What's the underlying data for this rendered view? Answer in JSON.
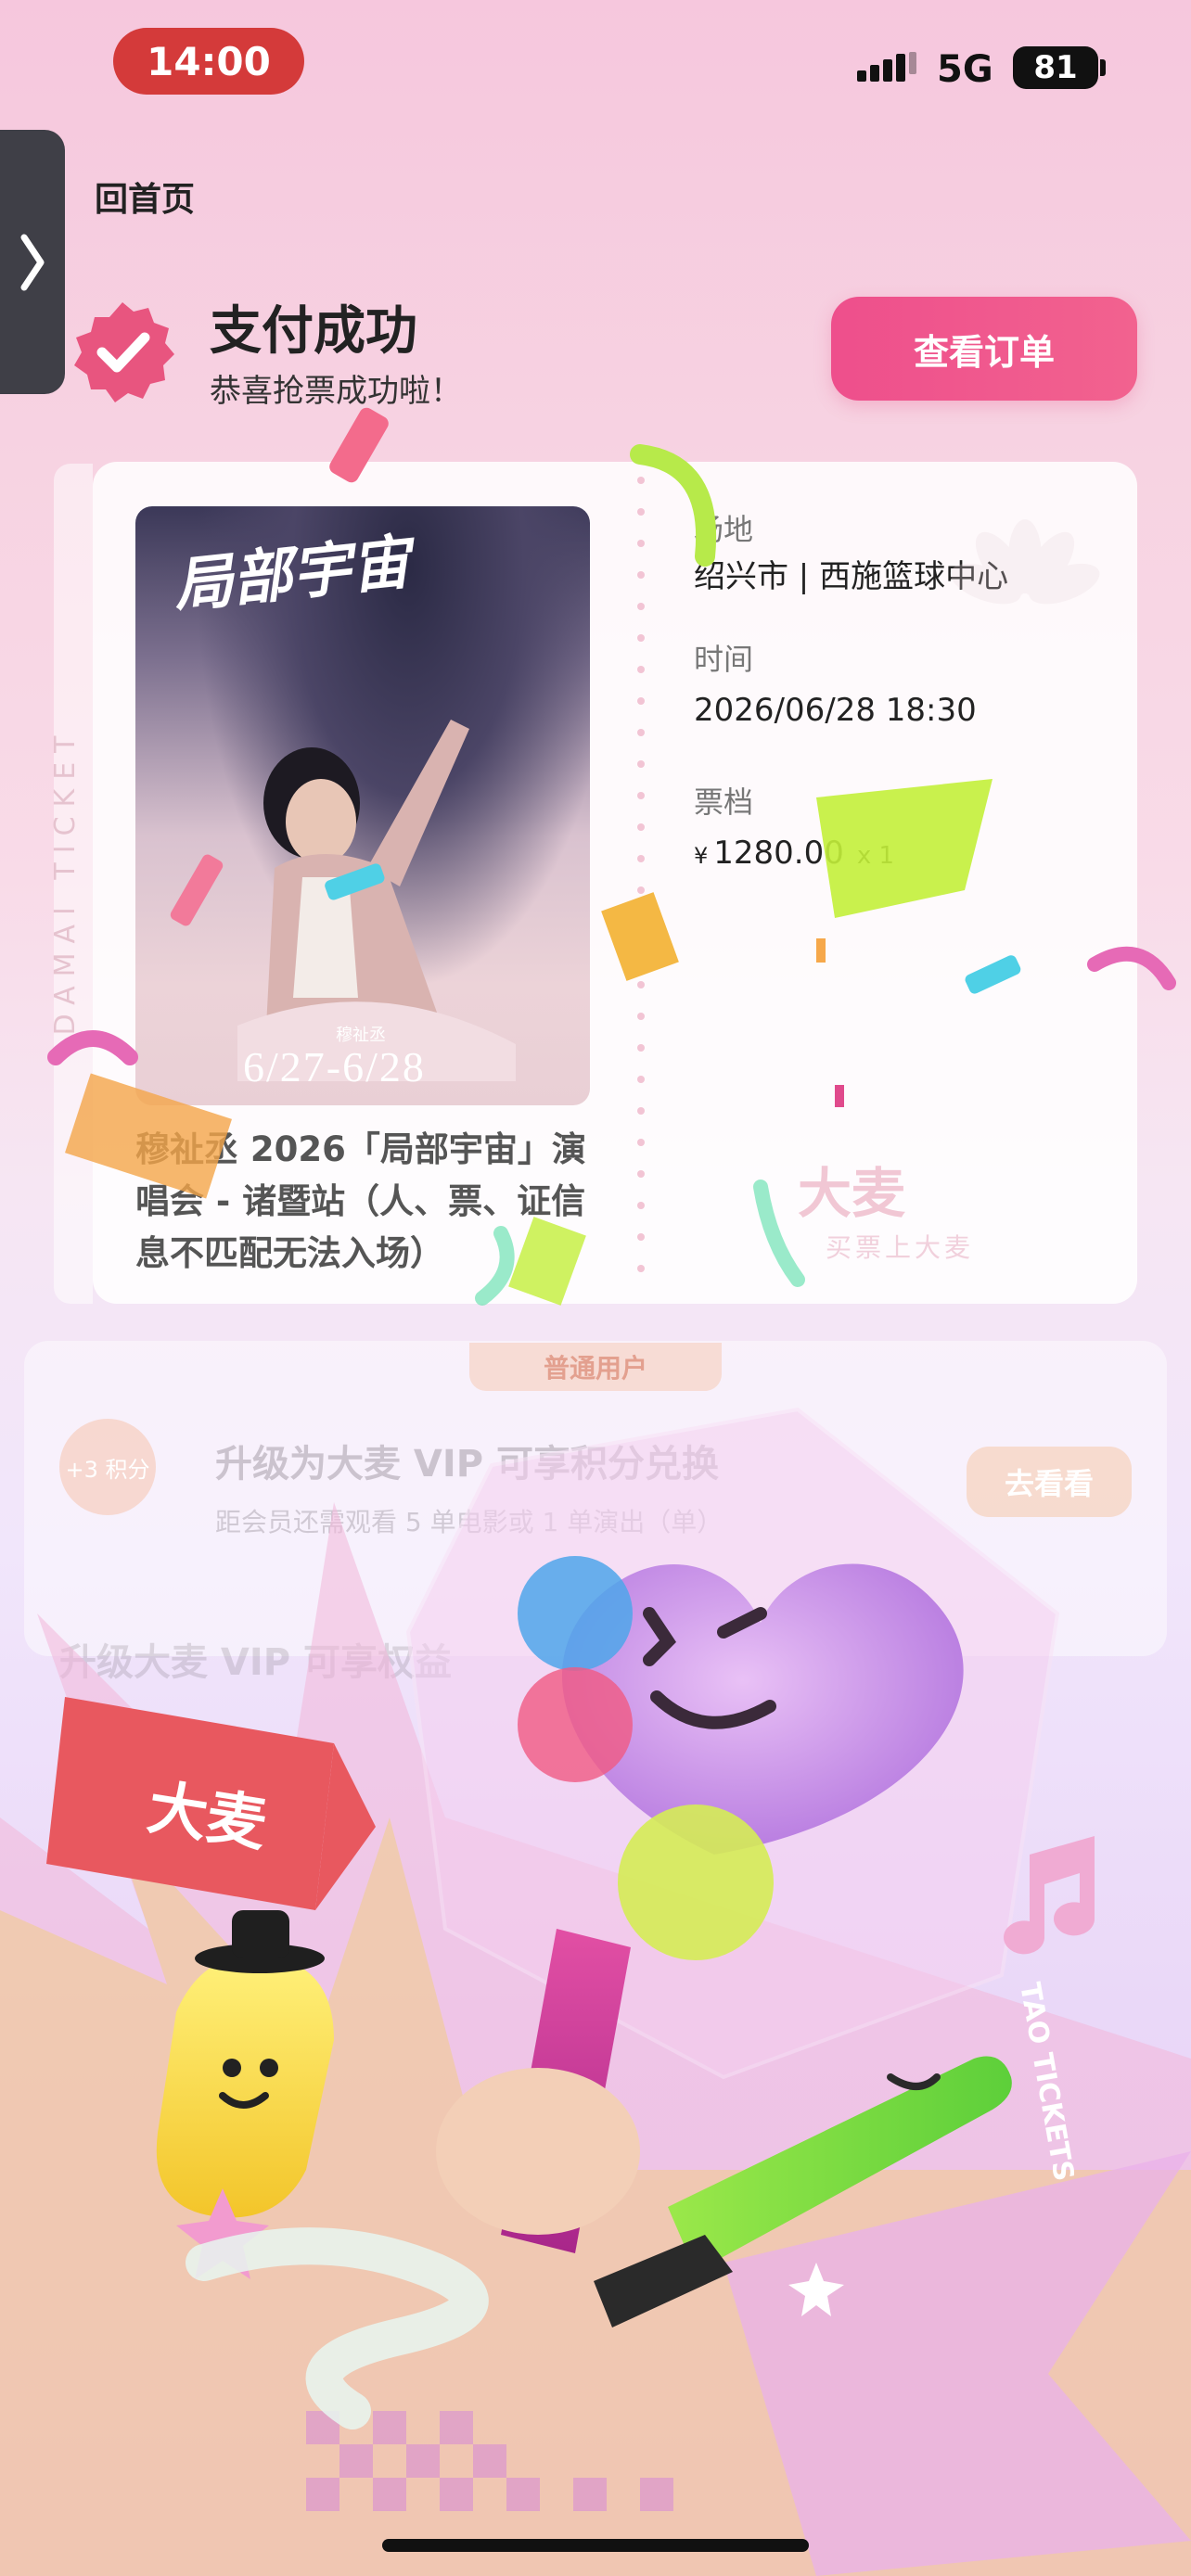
{
  "status_bar": {
    "time": "14:00",
    "network": "5G",
    "battery": "81"
  },
  "nav": {
    "home_link": "回首页"
  },
  "success": {
    "title": "支付成功",
    "subtitle": "恭喜抢票成功啦！",
    "view_order_label": "查看订单"
  },
  "ticket": {
    "side_text": "DAMAI TICKET",
    "poster": {
      "title": "局部宇宙",
      "artist": "穆祉丞",
      "date": "6/27-6/28"
    },
    "event_title": "穆祉丞 2026「局部宇宙」演唱会 - 诸暨站（人、票、证信息不匹配无法入场）",
    "venue_label": "场地",
    "venue_value": "绍兴市 | 西施篮球中心",
    "time_label": "时间",
    "time_value": "2026/06/28 18:30",
    "tier_label": "票档",
    "tier_currency": "¥",
    "tier_price": "1280.00",
    "tier_qty": "x 1",
    "brand_logo": "大麦",
    "brand_slogan": "买票上大麦"
  },
  "vip": {
    "tag": "普通用户",
    "points_badge": "+3 积分",
    "title": "升级为大麦 VIP 可享积分兑换",
    "subtitle": "距会员还需观看 5 单电影或 1 单演出（单）",
    "button": "去看看",
    "rights_title": "升级大麦 VIP 可享权益"
  },
  "illustration": {
    "tag_brand": "大麦",
    "stick_text": "TAO TICKETS"
  },
  "colors": {
    "accent": "#ee4f8c",
    "time_pill": "#d43a3a",
    "success_badge": "#e8557f"
  }
}
